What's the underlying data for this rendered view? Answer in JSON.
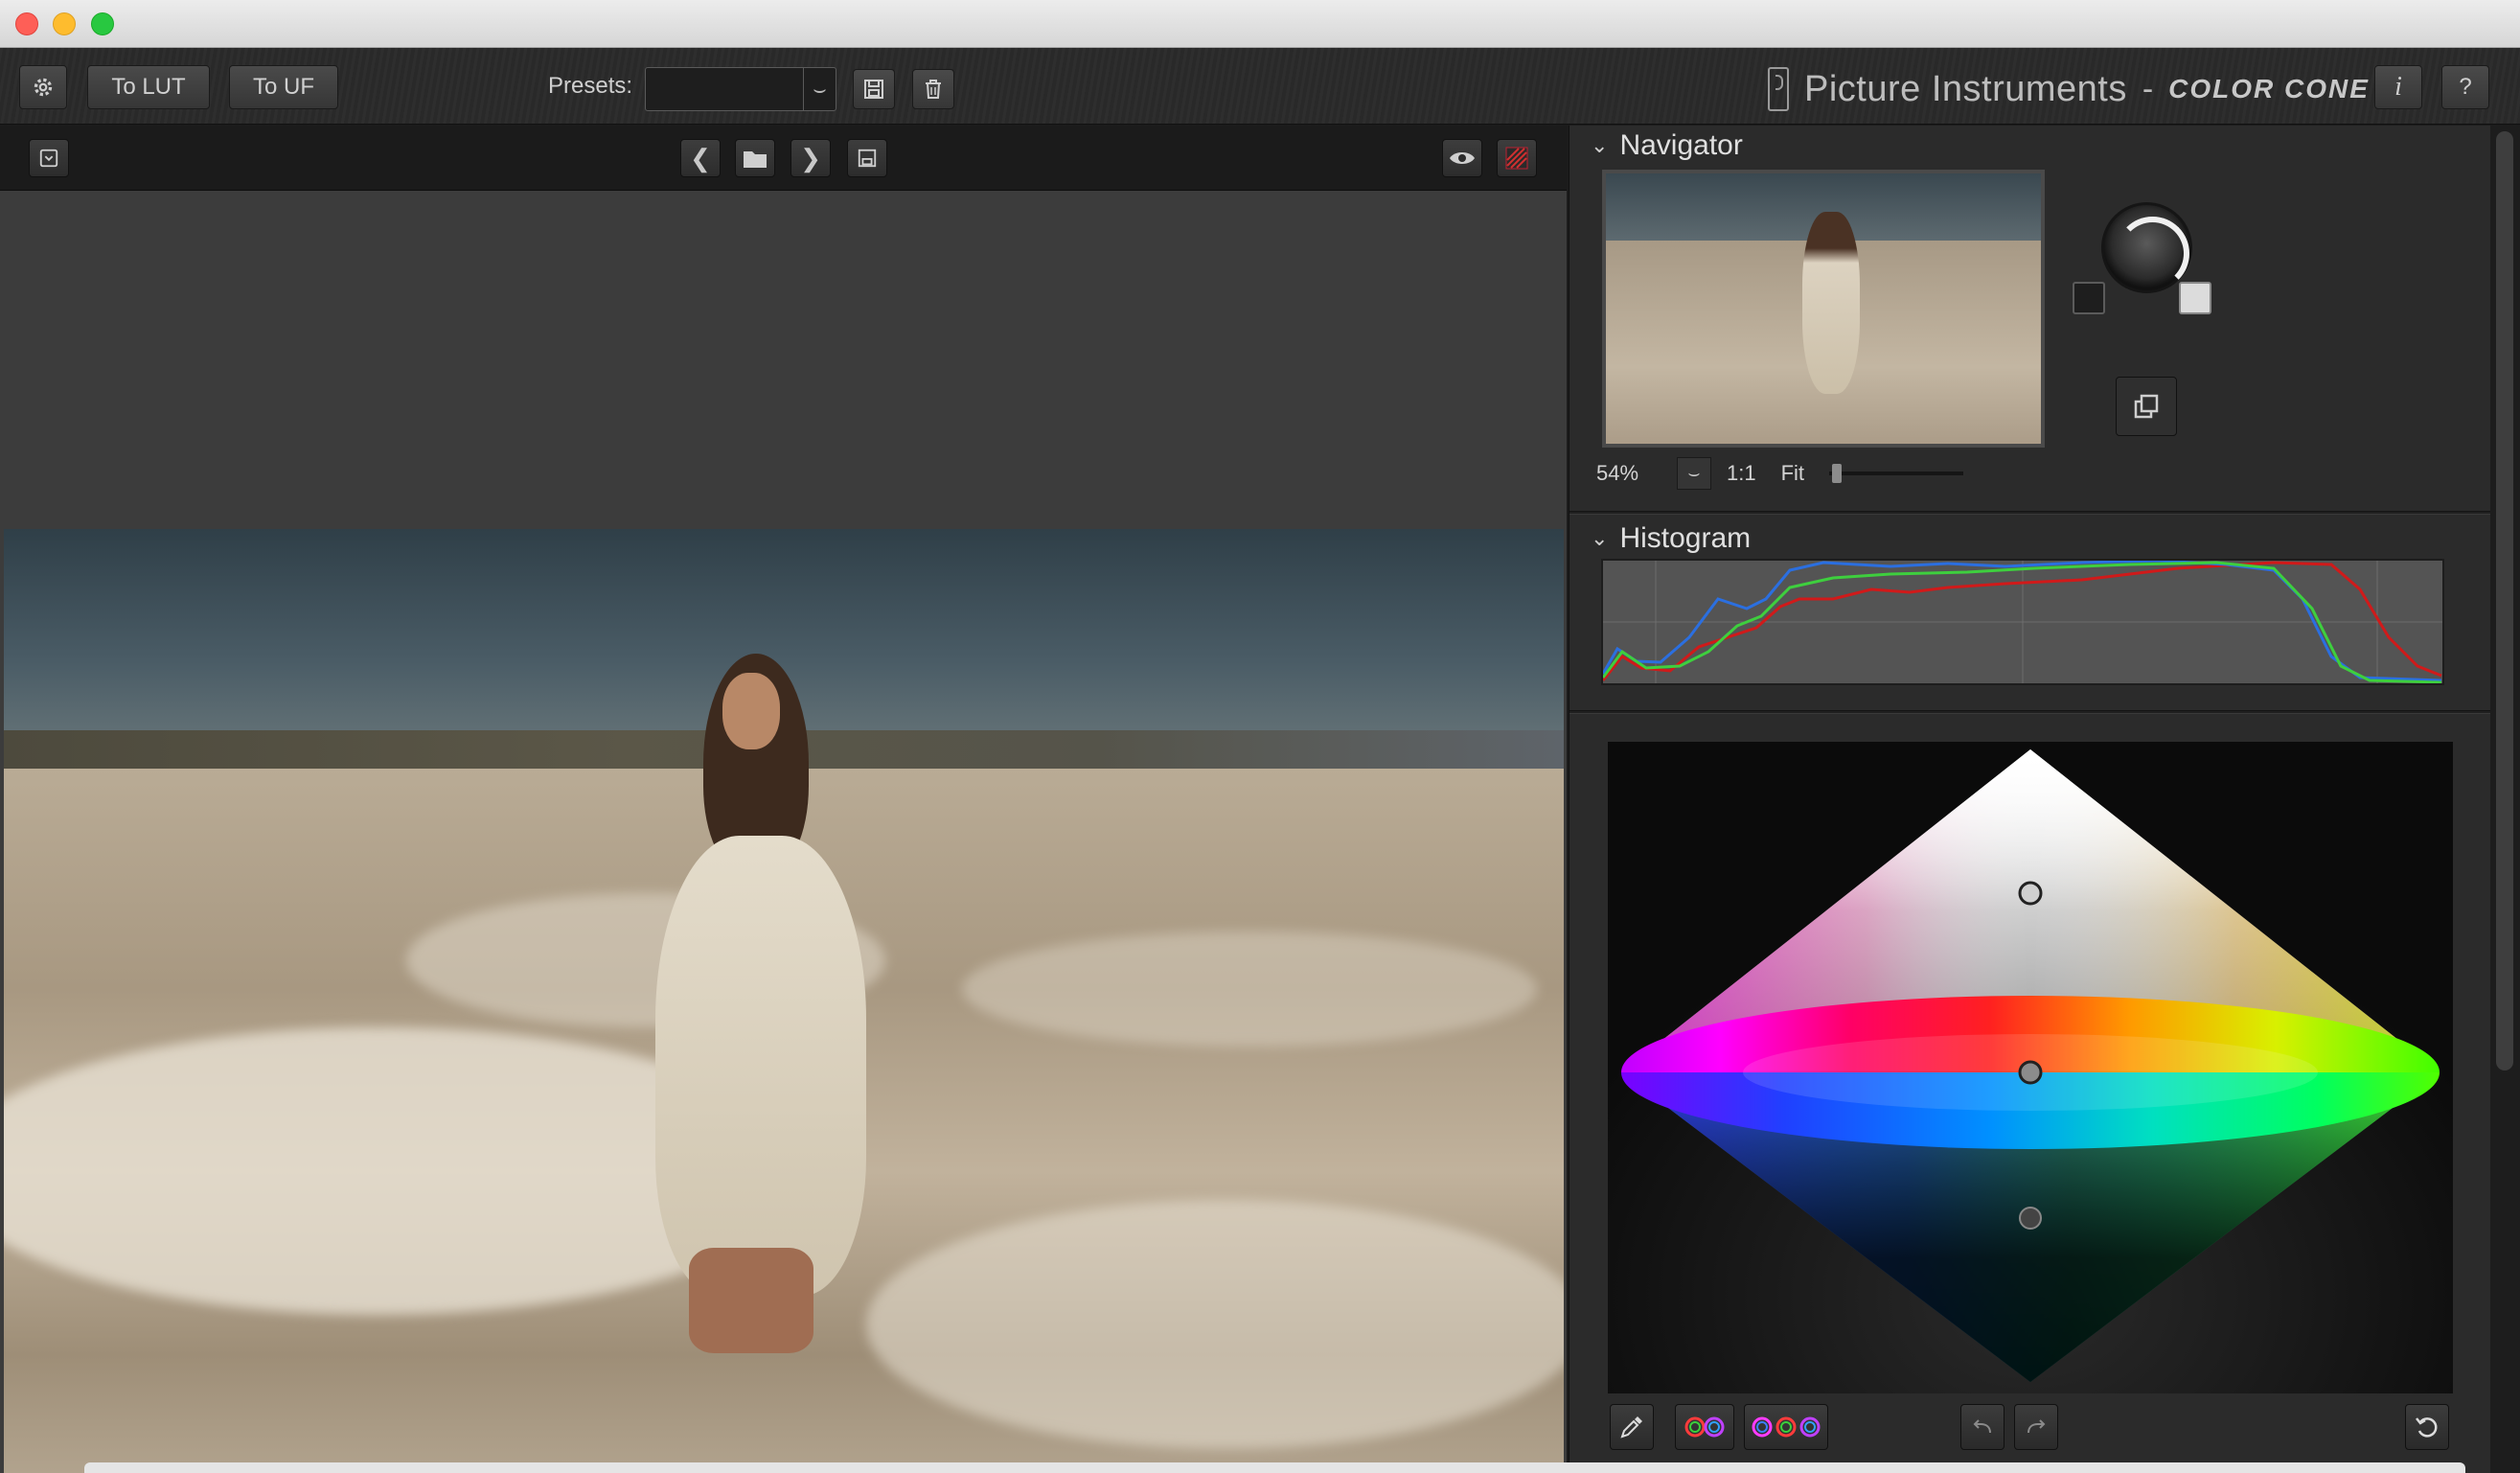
{
  "toolbar": {
    "settings_icon": "gear-icon",
    "to_lut_label": "To LUT",
    "to_uf_label": "To UF",
    "presets_label": "Presets:",
    "preset_value": "",
    "save_preset_icon": "save-icon",
    "delete_preset_icon": "trash-icon",
    "brand_name": "Picture Instruments",
    "brand_separator": "-",
    "product_name": "COLOR CONE",
    "info_label": "i",
    "help_label": "?"
  },
  "view_toolbar": {
    "left_icon": "dropdown-box-icon",
    "prev_label": "❮",
    "next_label": "❯",
    "open_icon": "folder-icon",
    "save_icon": "save-icon",
    "preview_icon": "eye-icon",
    "compare_icon": "split-view-icon"
  },
  "navigator": {
    "title": "Navigator",
    "zoom_value": "54%",
    "zoom_1_1": "1:1",
    "zoom_fit": "Fit",
    "zoom_slider_fraction": 0.02
  },
  "histogram": {
    "title": "Histogram",
    "colors": {
      "red": "#d01a1a",
      "green": "#3ecf3e",
      "blue": "#2b6fe0"
    }
  },
  "color_cone": {
    "tools": [
      "eyedropper-icon",
      "two-rings-icon",
      "three-rings-icon",
      "undo-icon",
      "redo-icon",
      "reset-icon"
    ]
  }
}
